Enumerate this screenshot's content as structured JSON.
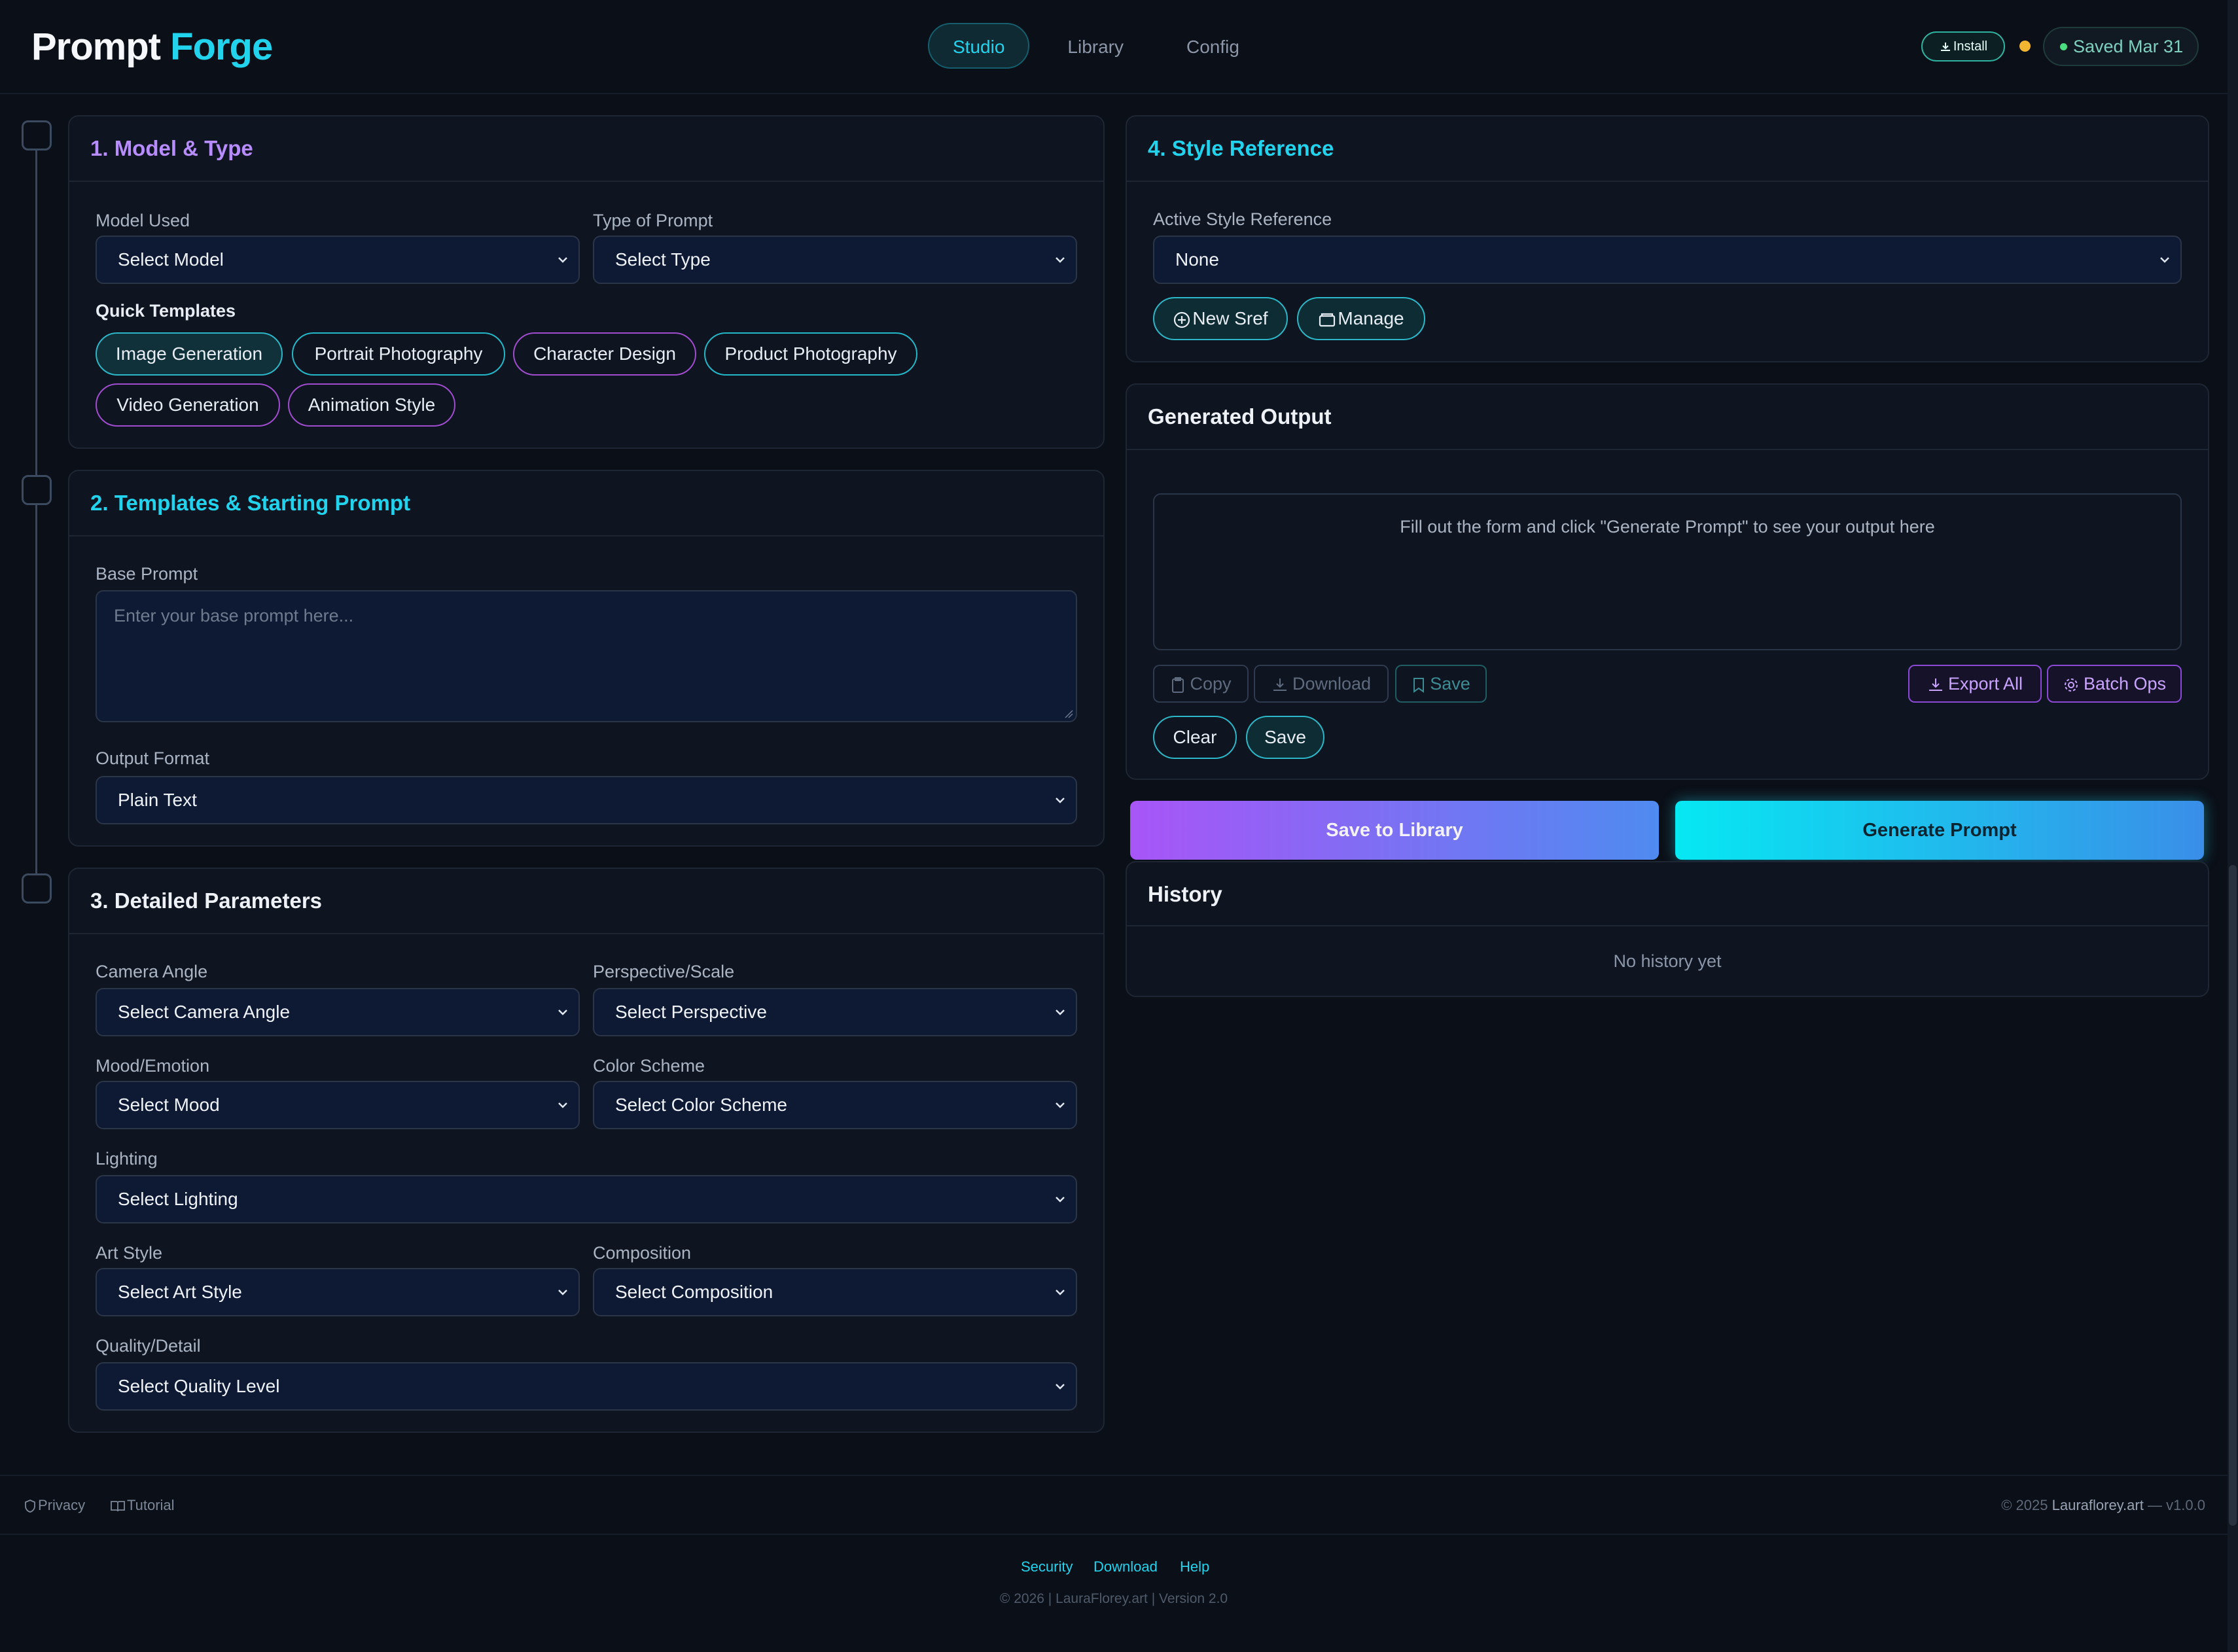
{
  "header": {
    "logo_a": "Prompt",
    "logo_b": "Forge",
    "tabs": [
      "Studio",
      "Library",
      "Config"
    ],
    "install": "Install",
    "saved": "Saved Mar 31"
  },
  "section1": {
    "title": "1. Model & Type",
    "model_label": "Model Used",
    "model_value": "Select Model",
    "type_label": "Type of Prompt",
    "type_value": "Select Type",
    "templates_label": "Quick Templates",
    "templates": [
      "Image Generation",
      "Portrait Photography",
      "Character Design",
      "Product Photography",
      "Video Generation",
      "Animation Style"
    ]
  },
  "section2": {
    "title": "2. Templates & Starting Prompt",
    "base_label": "Base Prompt",
    "base_placeholder": "Enter your base prompt here...",
    "format_label": "Output Format",
    "format_value": "Plain Text"
  },
  "section3": {
    "title": "3. Detailed Parameters",
    "camera_label": "Camera Angle",
    "camera_value": "Select Camera Angle",
    "perspective_label": "Perspective/Scale",
    "perspective_value": "Select Perspective",
    "mood_label": "Mood/Emotion",
    "mood_value": "Select Mood",
    "color_label": "Color Scheme",
    "color_value": "Select Color Scheme",
    "lighting_label": "Lighting",
    "lighting_value": "Select Lighting",
    "art_label": "Art Style",
    "art_value": "Select Art Style",
    "composition_label": "Composition",
    "composition_value": "Select Composition",
    "quality_label": "Quality/Detail",
    "quality_value": "Select Quality Level"
  },
  "section4": {
    "title": "4. Style Reference",
    "active_label": "Active Style Reference",
    "active_value": "None",
    "new_sref": "New Sref",
    "manage": "Manage"
  },
  "output": {
    "title": "Generated Output",
    "placeholder": "Fill out the form and click \"Generate Prompt\" to see your output here",
    "copy": "Copy",
    "download": "Download",
    "save": "Save",
    "export_all": "Export All",
    "batch_ops": "Batch Ops",
    "clear": "Clear",
    "save2": "Save"
  },
  "actions": {
    "save_library": "Save to Library",
    "generate": "Generate Prompt"
  },
  "history": {
    "title": "History",
    "empty": "No history yet"
  },
  "footer": {
    "privacy": "Privacy",
    "tutorial": "Tutorial",
    "copyright_pre": "© 2025",
    "copyright_site": "Lauraflorey.art",
    "version": "— v1.0.0",
    "links": [
      "Security",
      "Download",
      "Help"
    ],
    "copyright2": "© 2026 | LauraFlorey.art | Version 2.0"
  },
  "colors": {
    "accent_cyan": "#22d3ee",
    "accent_purple": "#a855f7",
    "background": "#0b0f17"
  }
}
